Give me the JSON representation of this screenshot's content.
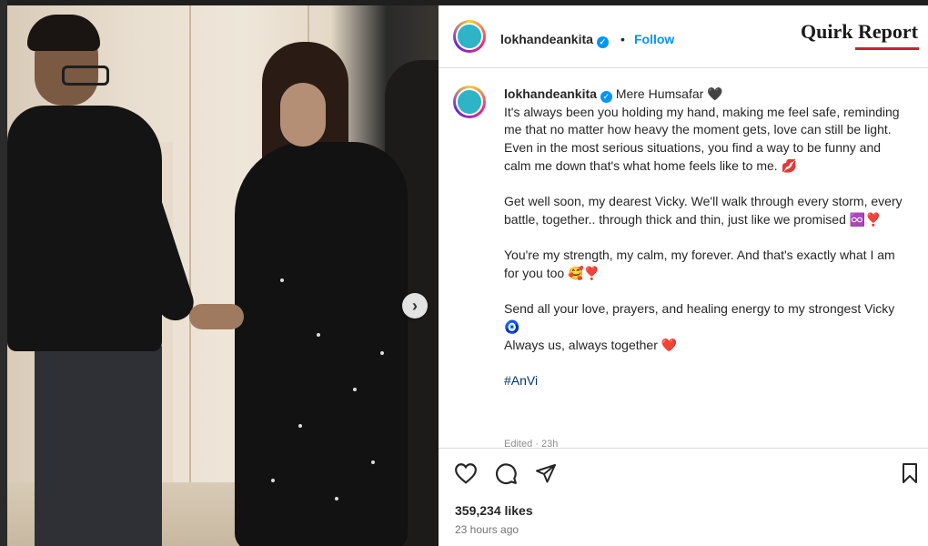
{
  "post": {
    "username": "lokhandeankita",
    "separator": "•",
    "follow_label": "Follow",
    "verified_mark": "✓"
  },
  "watermark": {
    "text": "Quirk Report"
  },
  "caption": {
    "username": "lokhandeankita",
    "title": "Mere Humsafar 🖤",
    "para1": "It's always been you holding my hand, making me feel safe, reminding me that no matter how heavy the moment gets, love can still be light. Even in the most serious situations, you find a way to be funny and calm me down that's what home feels like to me. 💋",
    "para2": "Get well soon, my dearest Vicky. We'll walk through every storm, every battle, together.. through thick and thin, just like we promised ♾️❣️",
    "para3": "You're my strength, my calm, my forever. And that's exactly what I am for you too 🥰❣️",
    "para4_line1": "Send all your love, prayers, and healing energy to my strongest Vicky 🧿",
    "para4_line2": "Always us, always together ❤️",
    "hashtag": "#AnVi",
    "edited": "Edited · 23h"
  },
  "actions": {
    "like_icon": "heart-icon",
    "comment_icon": "comment-icon",
    "share_icon": "share-icon",
    "save_icon": "bookmark-icon"
  },
  "stats": {
    "likes": "359,234 likes",
    "time_ago": "23 hours ago"
  },
  "photo": {
    "next_icon": "chevron-right-icon",
    "next_glyph": "›"
  },
  "colors": {
    "link_blue": "#0095f6",
    "hashtag": "#00376b",
    "watermark_accent": "#d11f2f"
  }
}
